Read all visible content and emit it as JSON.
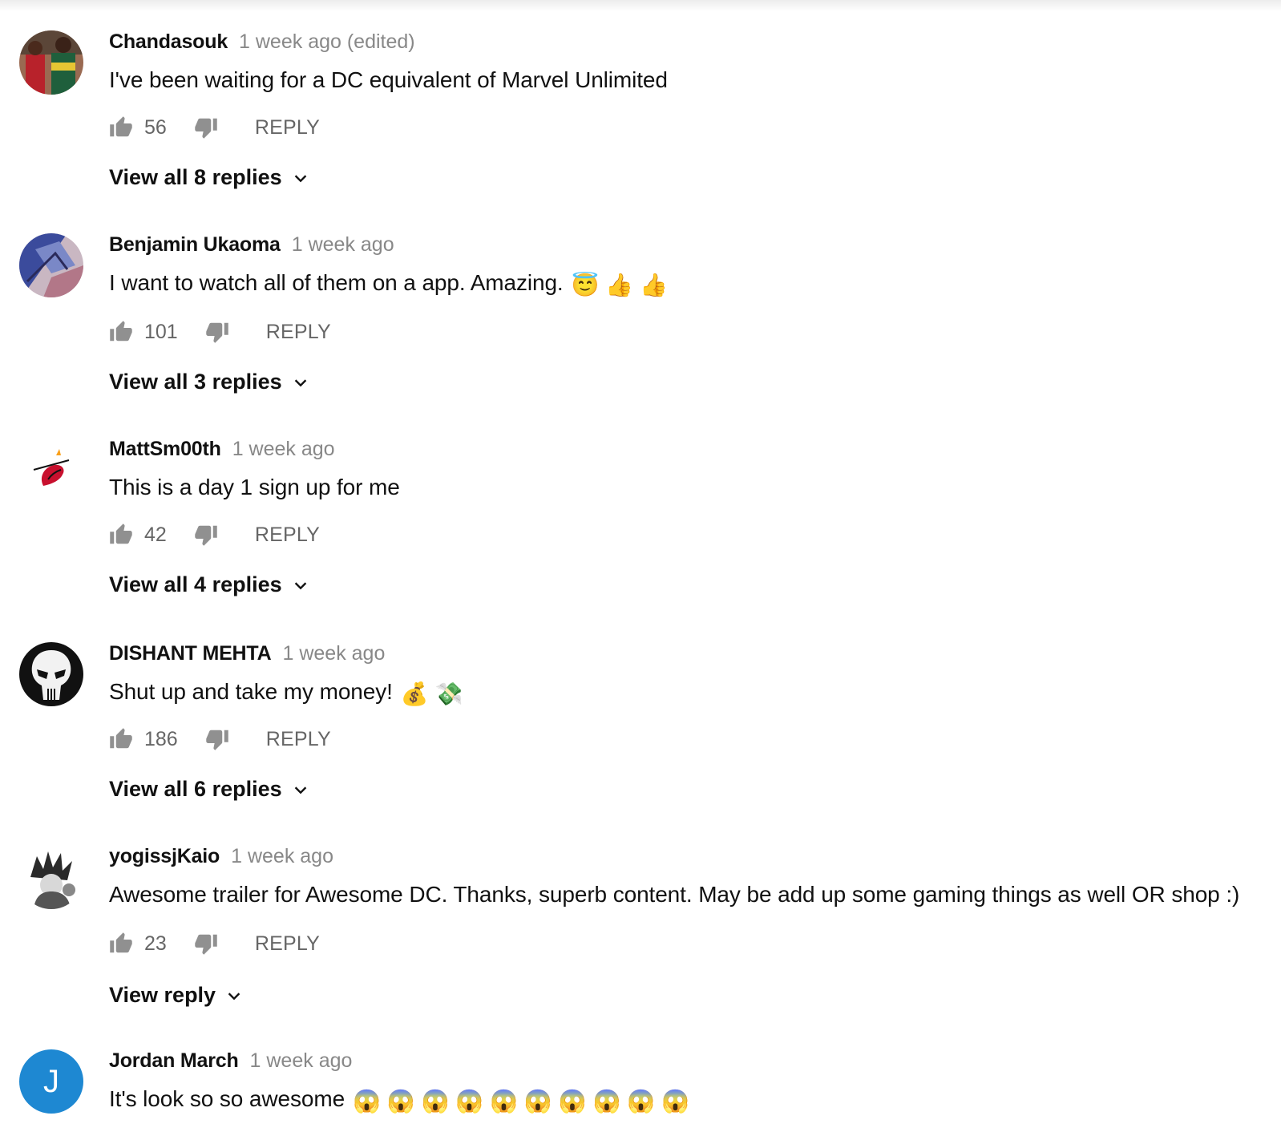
{
  "colors": {
    "muted": "#888888",
    "action": "#666666",
    "text": "#111111",
    "avatar_letter_bg": "#1e88d2"
  },
  "comments": [
    {
      "author": "Chandasouk",
      "time": "1 week ago (edited)",
      "text": "I've been waiting for a DC equivalent of Marvel Unlimited",
      "emojis": [],
      "likes": "56",
      "reply_label": "REPLY",
      "view_replies": "View all 8 replies",
      "avatar_icon": "basketball-players-avatar"
    },
    {
      "author": "Benjamin Ukaoma",
      "time": "1 week ago",
      "text": "I want to watch all of them on a app. Amazing.",
      "emojis": [
        "😇",
        "👍",
        "👍"
      ],
      "likes": "101",
      "reply_label": "REPLY",
      "view_replies": "View all 3 replies",
      "avatar_icon": "abstract-art-avatar"
    },
    {
      "author": "MattSm00th",
      "time": "1 week ago",
      "text": "This is a day 1 sign up for me",
      "emojis": [],
      "likes": "42",
      "reply_label": "REPLY",
      "view_replies": "View all 4 replies",
      "avatar_icon": "heat-logo-avatar"
    },
    {
      "author": "DISHANT MEHTA",
      "time": "1 week ago",
      "text": "Shut up and take my money!",
      "emojis": [
        "💰",
        "💸"
      ],
      "likes": "186",
      "reply_label": "REPLY",
      "view_replies": "View all 6 replies",
      "avatar_icon": "skull-avatar"
    },
    {
      "author": "yogissjKaio",
      "time": "1 week ago",
      "text": "Awesome trailer for Awesome DC. Thanks, superb content. May be add up some gaming things as well OR shop :)",
      "emojis": [],
      "likes": "23",
      "reply_label": "REPLY",
      "view_replies": "View reply",
      "avatar_icon": "anime-character-avatar"
    },
    {
      "author": "Jordan March",
      "time": "1 week ago",
      "text": "It's look so so awesome",
      "emojis": [
        "😱",
        "😱",
        "😱",
        "😱",
        "😱",
        "😱",
        "😱",
        "😱",
        "😱",
        "😱"
      ],
      "avatar_letter": "J",
      "avatar_icon": "letter-avatar"
    }
  ]
}
